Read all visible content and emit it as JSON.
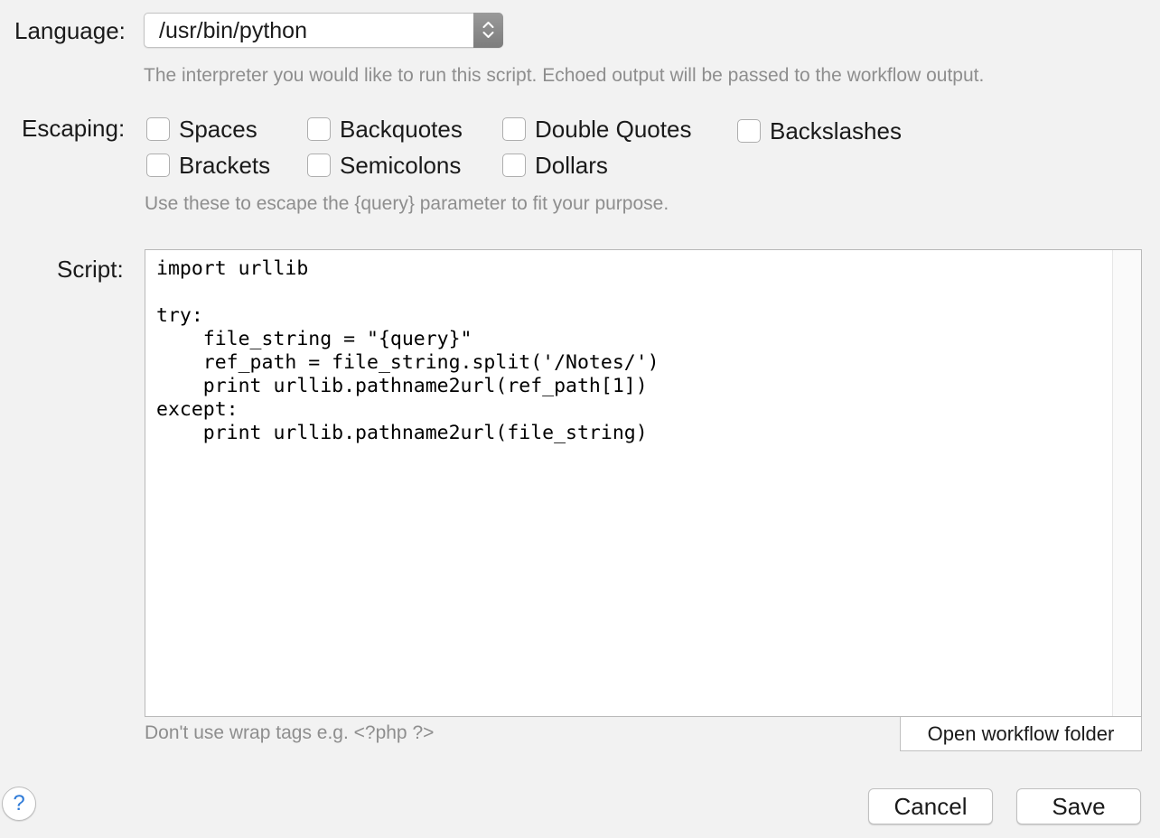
{
  "language": {
    "label": "Language:",
    "value": "/usr/bin/python",
    "hint": "The interpreter you would like to run this script. Echoed output will be passed to the workflow output."
  },
  "escaping": {
    "label": "Escaping:",
    "options": [
      {
        "label": "Spaces",
        "checked": false
      },
      {
        "label": "Backquotes",
        "checked": false
      },
      {
        "label": "Double Quotes",
        "checked": false
      },
      {
        "label": "Backslashes",
        "checked": false
      },
      {
        "label": "Brackets",
        "checked": false
      },
      {
        "label": "Semicolons",
        "checked": false
      },
      {
        "label": "Dollars",
        "checked": false
      }
    ],
    "hint": "Use these to escape the {query} parameter to fit your purpose."
  },
  "script": {
    "label": "Script:",
    "code": "import urllib\n\ntry:\n    file_string = \"{query}\"\n    ref_path = file_string.split('/Notes/')\n    print urllib.pathname2url(ref_path[1])\nexcept:\n    print urllib.pathname2url(file_string)",
    "hint": "Don't use wrap tags e.g. <?php ?>",
    "open_folder_label": "Open workflow folder"
  },
  "footer": {
    "help_label": "?",
    "cancel_label": "Cancel",
    "save_label": "Save"
  }
}
